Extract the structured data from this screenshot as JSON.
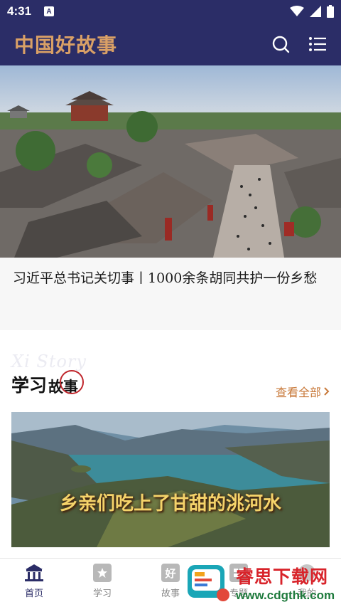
{
  "status_bar": {
    "time": "4:31",
    "a_badge": "A",
    "icons": [
      "wifi-icon",
      "signal-icon",
      "battery-icon"
    ]
  },
  "header": {
    "title": "中国好故事",
    "icons": [
      "search-icon",
      "menu-list-icon"
    ]
  },
  "hero": {
    "title": "习近平总书记关切事丨1000余条胡同共护一份乡愁"
  },
  "section": {
    "ghost_text": "Xi Story",
    "title_part1": "学习",
    "title_part2": "故事",
    "view_all": "查看全部",
    "card_caption": "乡亲们吃上了甘甜的洮河水"
  },
  "bottom_nav": {
    "items": [
      {
        "label": "首页",
        "icon": "home-icon",
        "active": true
      },
      {
        "label": "学习",
        "icon": "star-icon",
        "active": false
      },
      {
        "label": "故事",
        "icon": "hao-char-icon",
        "glyph": "好",
        "active": false
      },
      {
        "label": "专题",
        "icon": "topic-icon",
        "active": false
      },
      {
        "label": "我的",
        "icon": "profile-icon",
        "active": false
      }
    ]
  },
  "watermark": {
    "name": "睿思下载网",
    "url": "www.cdgthk.com"
  },
  "colors": {
    "brand_navy": "#2b2d67",
    "title_gold": "#d9a066",
    "accent_orange": "#c8793a",
    "circle_red": "#c0272d"
  }
}
